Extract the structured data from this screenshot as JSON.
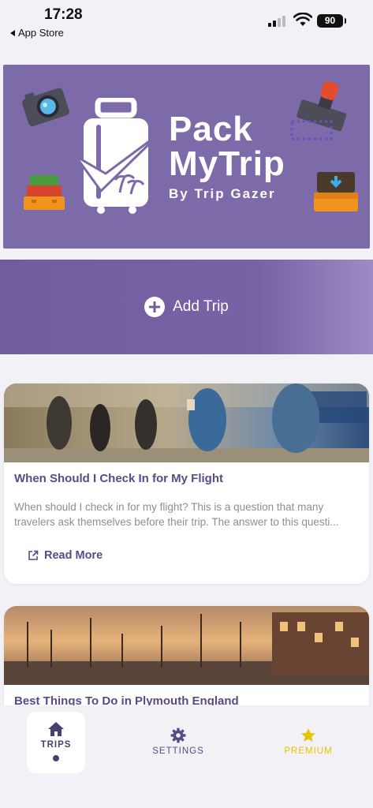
{
  "status_bar": {
    "time": "17:28",
    "back_label": "App Store",
    "battery": "90"
  },
  "hero": {
    "line1": "Pack",
    "line2": "MyTrip",
    "tagline": "By Trip Gazer"
  },
  "add_trip": {
    "label": "Add Trip"
  },
  "articles": [
    {
      "title": "When Should I Check In for My Flight",
      "excerpt": "When should I check in for my flight? This is a question that many travelers ask themselves before their trip. The answer to this questi...",
      "read_more": "Read More"
    },
    {
      "title": "Best Things To Do in Plymouth England"
    }
  ],
  "nav": {
    "tabs": [
      {
        "label": "TRIPS",
        "icon": "home-icon",
        "active": true
      },
      {
        "label": "SETTINGS",
        "icon": "gear-icon"
      },
      {
        "label": "PREMIUM",
        "icon": "star-icon"
      }
    ]
  },
  "colors": {
    "brand_purple": "#7d6aa9",
    "accent_text": "#5a4a86",
    "premium": "#e8c400"
  }
}
